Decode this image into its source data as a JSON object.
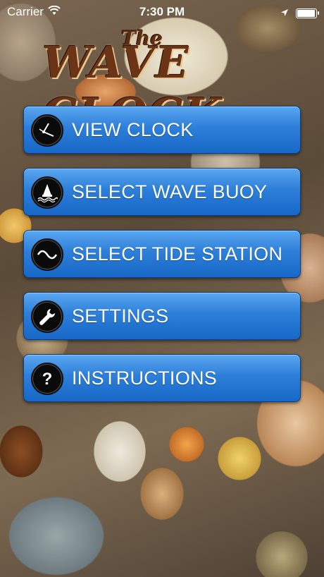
{
  "status_bar": {
    "carrier": "Carrier",
    "time": "7:30 PM"
  },
  "logo": {
    "the": "The",
    "wave": "WAVE",
    "clock": "CLOCK"
  },
  "menu": [
    {
      "label": "VIEW CLOCK",
      "icon": "clock-icon"
    },
    {
      "label": "SELECT WAVE BUOY",
      "icon": "buoy-icon"
    },
    {
      "label": "SELECT TIDE STATION",
      "icon": "wave-icon"
    },
    {
      "label": "SETTINGS",
      "icon": "wrench-icon"
    },
    {
      "label": "INSTRUCTIONS",
      "icon": "question-icon"
    }
  ],
  "colors": {
    "button_blue": "#2d7fd9",
    "logo_brown": "#6b3417"
  }
}
